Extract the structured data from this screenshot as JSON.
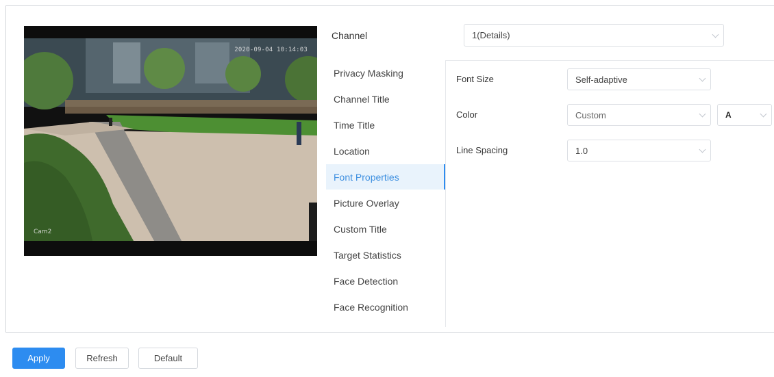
{
  "preview": {
    "timestamp": "2020-09-04 10:14:03",
    "camera_label": "Cam2"
  },
  "channel": {
    "label": "Channel",
    "value": "1(Details)"
  },
  "menu": {
    "items": [
      {
        "label": "Privacy Masking",
        "active": false
      },
      {
        "label": "Channel Title",
        "active": false
      },
      {
        "label": "Time Title",
        "active": false
      },
      {
        "label": "Location",
        "active": false
      },
      {
        "label": "Font Properties",
        "active": true
      },
      {
        "label": "Picture Overlay",
        "active": false
      },
      {
        "label": "Custom Title",
        "active": false
      },
      {
        "label": "Target Statistics",
        "active": false
      },
      {
        "label": "Face Detection",
        "active": false
      },
      {
        "label": "Face Recognition",
        "active": false
      }
    ]
  },
  "form": {
    "font_size": {
      "label": "Font Size",
      "value": "Self-adaptive"
    },
    "color": {
      "label": "Color",
      "value": "Custom",
      "swatch_text": "A"
    },
    "line_spacing": {
      "label": "Line Spacing",
      "value": "1.0"
    }
  },
  "buttons": {
    "apply": "Apply",
    "refresh": "Refresh",
    "default": "Default"
  },
  "colors": {
    "accent": "#2d8cf0",
    "active_bg": "#e9f3fc"
  }
}
